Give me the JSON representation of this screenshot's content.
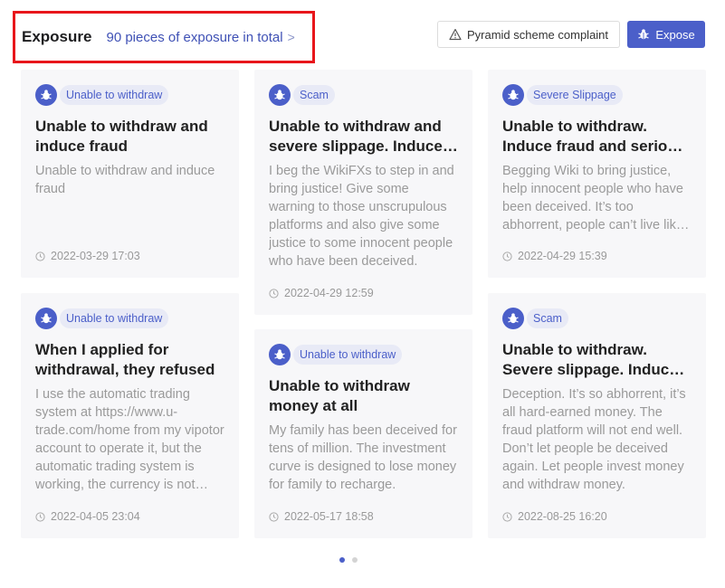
{
  "header": {
    "title": "Exposure",
    "total_text": "90 pieces of exposure in total",
    "chevron": ">",
    "complaint_label": "Pyramid scheme complaint",
    "expose_label": "Expose",
    "complaint_icon": "warning-triangle-icon",
    "expose_icon": "bug-icon"
  },
  "colors": {
    "accent": "#4b5fc9",
    "highlight_box": "#e8161b",
    "card_bg": "#f7f7f9",
    "tag_bg": "#e8eaf6"
  },
  "cards": [
    {
      "tag": "Unable to withdraw",
      "title": "Unable to withdraw and induce fraud",
      "body": "Unable to withdraw and induce fraud",
      "time": "2022-03-29 17:03"
    },
    {
      "tag": "Scam",
      "title": "Unable to withdraw and severe slippage. Induce fraud",
      "body": "I beg the WikiFXs to step in and bring justice! Give some warning to those unscrupulous platforms and also give some justice to some innocent people who have been deceived.",
      "time": "2022-04-29 12:59"
    },
    {
      "tag": "Severe Slippage",
      "title": "Unable to withdraw. Induce fraud and serious slippage",
      "body": "Begging Wiki to bring justice, help innocent people who have been deceived. It’s too abhorrent, people can’t live like this.",
      "time": "2022-04-29 15:39"
    },
    {
      "tag": "Unable to withdraw",
      "title": "When I applied for withdrawal, they refused",
      "body": "I use the automatic trading system at https://www.u-trade.com/home from my vipotor account to operate it, but the automatic trading system is working, the currency is not withdrawn.",
      "time": "2022-04-05 23:04"
    },
    {
      "tag": "Unable to withdraw",
      "title": "Unable to withdraw money at all",
      "body": "My family has been deceived for tens of million. The investment curve is designed to lose money for family to recharge.",
      "time": "2022-05-17 18:58"
    },
    {
      "tag": "Scam",
      "title": "Unable to withdraw. Severe slippage. Induce fraud",
      "body": "Deception. It’s so abhorrent, it’s all hard-earned money. The fraud platform will not end well. Don’t let people be deceived again. Let people invest money and withdraw money.",
      "time": "2022-08-25 16:20"
    }
  ],
  "pagination": {
    "pages": 2,
    "current": 1
  }
}
